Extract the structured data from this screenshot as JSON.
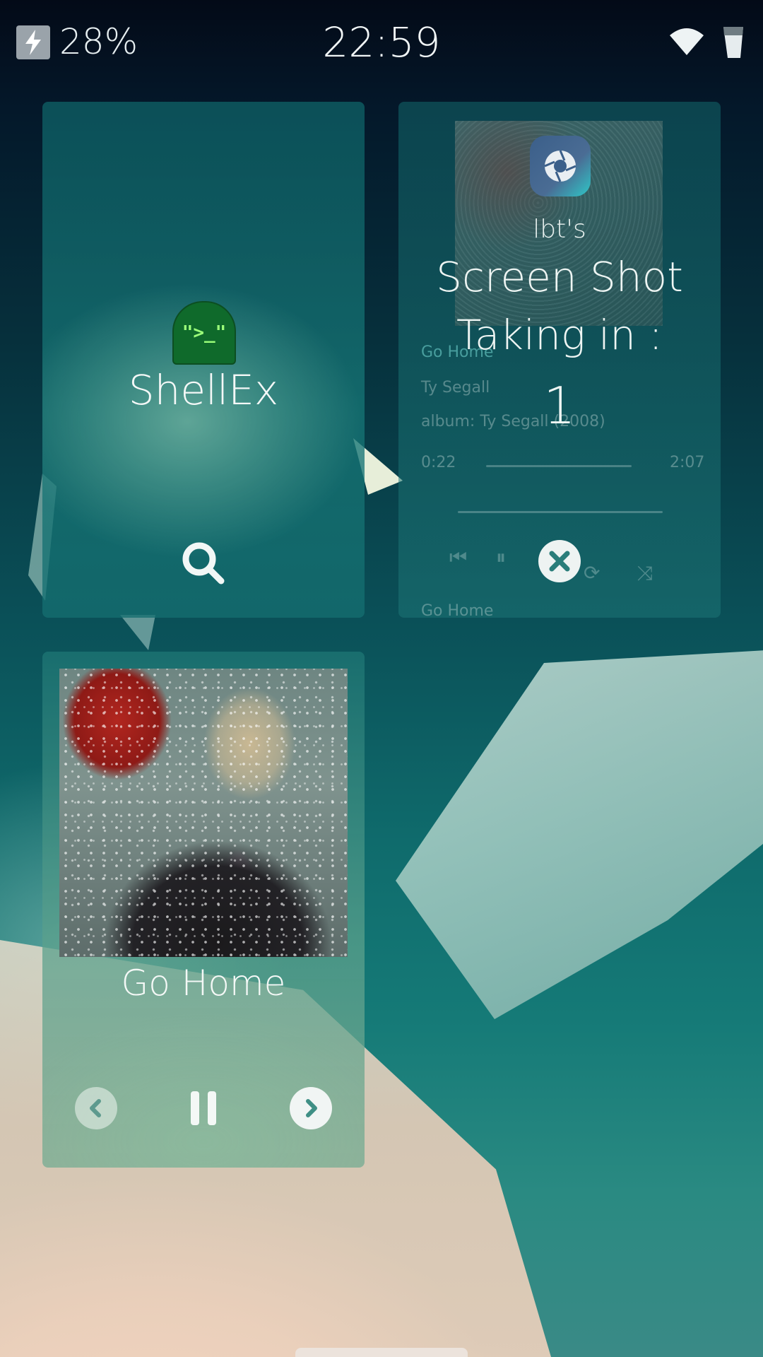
{
  "status_bar": {
    "battery_percent": "28%",
    "time": "22:59",
    "icons": [
      "charging-bolt-icon",
      "wifi-icon",
      "cellular-signal-icon"
    ]
  },
  "cards": {
    "shellex": {
      "app_name": "ShellEx",
      "icon_text": "\">_\"",
      "action_icon": "search-icon"
    },
    "screenshot": {
      "user": "lbt's",
      "title_line1": "Screen Shot",
      "title_line2": "Taking in :",
      "countdown": "1",
      "close_icon": "close-icon",
      "background_player": {
        "track": "Go Home",
        "artist": "Ty Segall",
        "album": "album: Ty Segall (2008)",
        "elapsed": "0:22",
        "duration": "2:07",
        "next_track": "Go Home"
      }
    },
    "media_player": {
      "track_title": "Go Home",
      "controls": [
        "previous-icon",
        "pause-icon",
        "next-icon"
      ]
    }
  },
  "colors": {
    "accent_teal": "#0f6b6c",
    "shell_green": "#9cff7a"
  }
}
